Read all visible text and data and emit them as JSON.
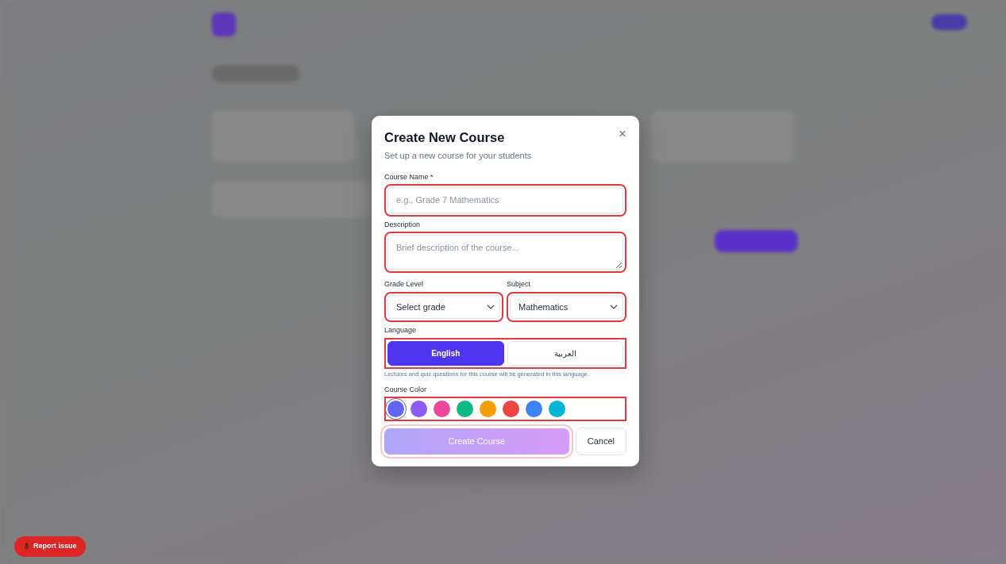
{
  "dialog": {
    "title": "Create New Course",
    "subtitle": "Set up a new course for your students",
    "close": "×",
    "fields": [
      {
        "kind": "text",
        "label": "Course Name *",
        "placeholder": "e.g., Grade 7 Mathematics",
        "highlighted": true
      },
      {
        "kind": "textarea",
        "label": "Description",
        "placeholder": "Brief description of the course...",
        "highlighted": true
      }
    ],
    "selects": [
      {
        "label": "Grade Level",
        "value": "Select grade",
        "highlighted": true
      },
      {
        "label": "Subject",
        "value": "Mathematics",
        "highlighted": true
      }
    ],
    "language": {
      "label": "Language",
      "highlighted": true,
      "options": [
        {
          "label": "English",
          "selected": true
        },
        {
          "label": "العربية",
          "selected": false
        }
      ],
      "hint": "Lectures and quiz questions for this course will be generated in this language."
    },
    "course_color": {
      "label": "Course Color",
      "highlighted": true,
      "swatches": [
        {
          "color": "#6366f1",
          "selected": true
        },
        {
          "color": "#8b5cf6",
          "selected": false
        },
        {
          "color": "#ec4899",
          "selected": false
        },
        {
          "color": "#10b981",
          "selected": false
        },
        {
          "color": "#f59e0b",
          "selected": false
        },
        {
          "color": "#ef4444",
          "selected": false
        },
        {
          "color": "#3b82f6",
          "selected": false
        },
        {
          "color": "#06b6d4",
          "selected": false
        }
      ]
    },
    "buttons": [
      {
        "kind": "primary",
        "label": "Create Course",
        "disabled": true,
        "highlighted": true
      },
      {
        "kind": "secondary",
        "label": "Cancel",
        "highlighted": false
      }
    ]
  },
  "report_button": {
    "label": "Report issue"
  }
}
